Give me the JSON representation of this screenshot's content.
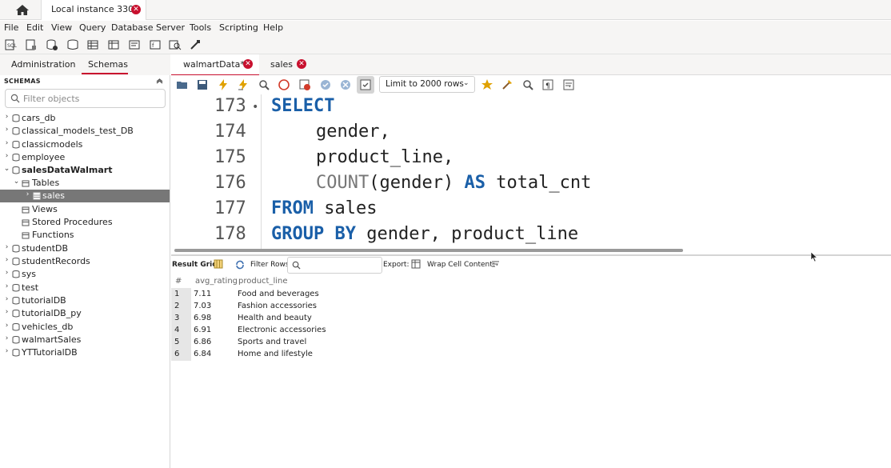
{
  "connection_tab": {
    "label": "Local instance 3306"
  },
  "menu": [
    "File",
    "Edit",
    "View",
    "Query",
    "Database",
    "Server",
    "Tools",
    "Scripting",
    "Help"
  ],
  "navigator": {
    "tabs": [
      "Administration",
      "Schemas"
    ],
    "active_tab": "Schemas",
    "header": "SCHEMAS",
    "filter_placeholder": "Filter objects",
    "tree": [
      {
        "label": "cars_db"
      },
      {
        "label": "classical_models_test_DB"
      },
      {
        "label": "classicmodels"
      },
      {
        "label": "employee"
      },
      {
        "label": "salesDataWalmart"
      },
      {
        "label": "Tables"
      },
      {
        "label": "sales"
      },
      {
        "label": "Views"
      },
      {
        "label": "Stored Procedures"
      },
      {
        "label": "Functions"
      },
      {
        "label": "studentDB"
      },
      {
        "label": "studentRecords"
      },
      {
        "label": "sys"
      },
      {
        "label": "test"
      },
      {
        "label": "tutorialDB"
      },
      {
        "label": "tutorialDB_py"
      },
      {
        "label": "vehicles_db"
      },
      {
        "label": "walmartSales"
      },
      {
        "label": "YTTutorialDB"
      }
    ]
  },
  "editor": {
    "tabs": [
      "walmartData*",
      "sales"
    ],
    "active_tab": "walmartData*",
    "limit_select": "Limit to 2000 rows",
    "lines": [
      {
        "num": "173",
        "marker": "•"
      },
      {
        "num": "174"
      },
      {
        "num": "175"
      },
      {
        "num": "176"
      },
      {
        "num": "177"
      },
      {
        "num": "178"
      }
    ],
    "code": {
      "l173_kw": "SELECT",
      "l174": "gender,",
      "l175": "product_line,",
      "l176_fn": "COUNT",
      "l176_mid": "(gender) ",
      "l176_kw": "AS",
      "l176_end": " total_cnt",
      "l177_kw": "FROM",
      "l177_end": " sales",
      "l178_kw": "GROUP BY",
      "l178_end": " gender, product_line"
    }
  },
  "result_toolbar": {
    "result_grid": "Result Grid",
    "filter_rows": "Filter Rows:",
    "export": "Export:",
    "wrap_cell": "Wrap Cell Content:"
  },
  "result": {
    "columns": [
      "#",
      "avg_rating",
      "product_line"
    ],
    "rows": [
      [
        "1",
        "7.11",
        "Food and beverages"
      ],
      [
        "2",
        "7.03",
        "Fashion accessories"
      ],
      [
        "3",
        "6.98",
        "Health and beauty"
      ],
      [
        "4",
        "6.91",
        "Electronic accessories"
      ],
      [
        "5",
        "6.86",
        "Sports and travel"
      ],
      [
        "6",
        "6.84",
        "Home and lifestyle"
      ]
    ]
  },
  "colors": {
    "accent_red": "#c8102e",
    "keyword_blue": "#1a5fa8",
    "selected_row": "#777777"
  }
}
